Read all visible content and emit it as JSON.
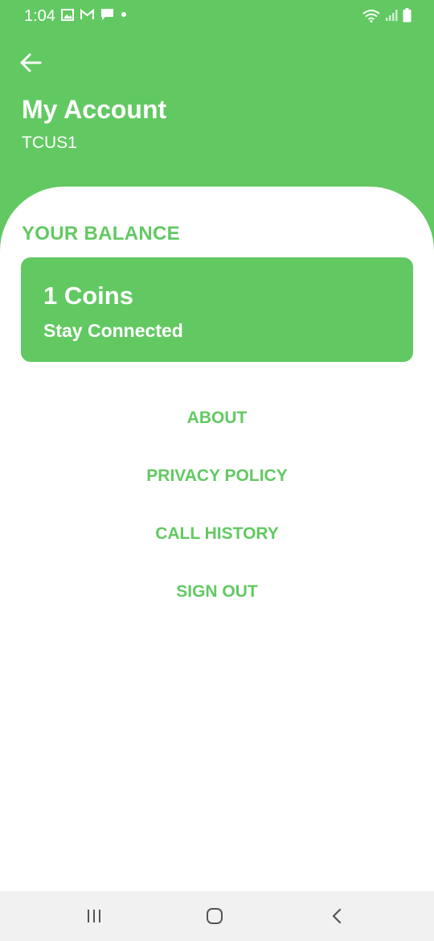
{
  "status_bar": {
    "time": "1:04",
    "left_icons": [
      "image-icon",
      "gmail-icon",
      "message-icon",
      "dot-icon"
    ],
    "right_icons": [
      "wifi-icon",
      "signal-icon",
      "battery-icon"
    ]
  },
  "header": {
    "title": "My Account",
    "username": "TCUS1"
  },
  "balance": {
    "label": "YOUR BALANCE",
    "coins": "1 Coins",
    "tagline": "Stay Connected"
  },
  "menu": {
    "about": "ABOUT",
    "privacy_policy": "PRIVACY POLICY",
    "call_history": "CALL HISTORY",
    "sign_out": "SIGN OUT"
  },
  "colors": {
    "accent": "#62c962",
    "background": "#ffffff",
    "nav_bar": "#f1f1f1"
  }
}
